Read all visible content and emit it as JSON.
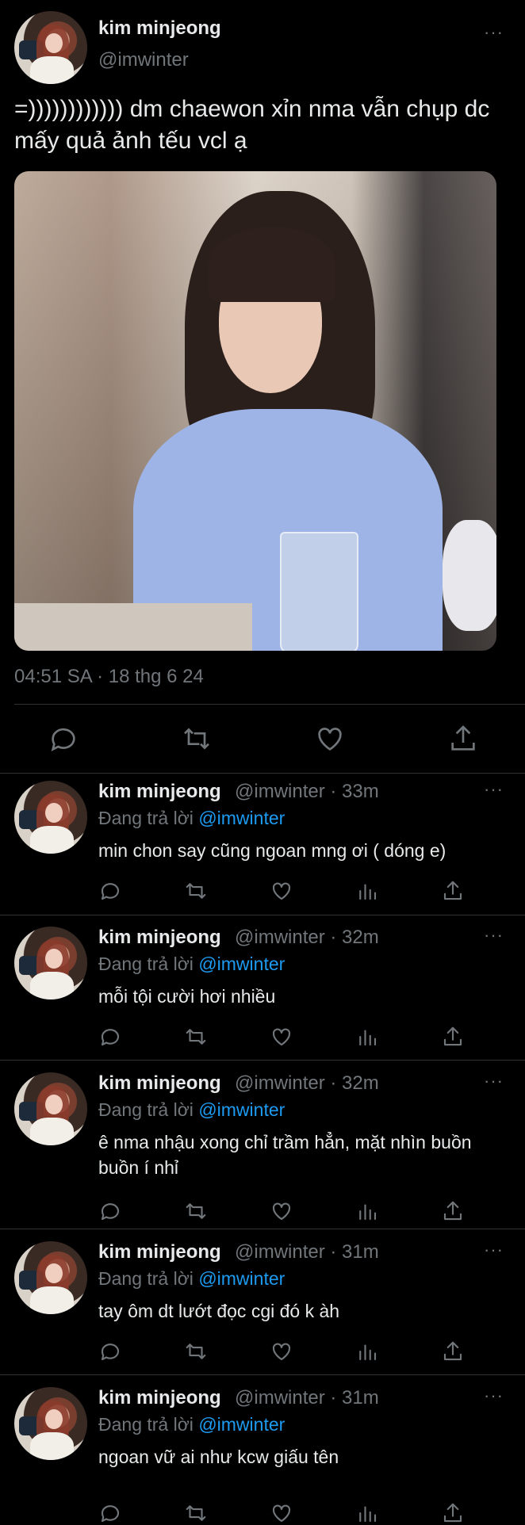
{
  "tweet": {
    "author_name": "kim minjeong",
    "author_handle": "@imwinter",
    "more_icon": "···",
    "text": "=)))))))))))) dm chaewon xỉn nma vẫn chụp dc mấy quả ảnh tếu vcl ạ",
    "timestamp": "04:51 SA · 18 thg 6 24"
  },
  "replies": [
    {
      "name": "kim minjeong",
      "handle": "@imwinter",
      "time": "· 33m",
      "replying_label": "Đang trả lời",
      "mention": "@imwinter",
      "text": "min chon say cũng ngoan mng ơi ( dóng e)"
    },
    {
      "name": "kim minjeong",
      "handle": "@imwinter",
      "time": "· 32m",
      "replying_label": "Đang trả lời",
      "mention": "@imwinter",
      "text": "mỗi tội cười hơi nhiều"
    },
    {
      "name": "kim minjeong",
      "handle": "@imwinter",
      "time": "· 32m",
      "replying_label": "Đang trả lời",
      "mention": "@imwinter",
      "text": "ê nma nhậu xong chỉ trầm hẳn, mặt nhìn buồn buồn í nhỉ"
    },
    {
      "name": "kim minjeong",
      "handle": "@imwinter",
      "time": "· 31m",
      "replying_label": "Đang trả lời",
      "mention": "@imwinter",
      "text": "tay ôm dt lướt đọc cgi đó k àh"
    },
    {
      "name": "kim minjeong",
      "handle": "@imwinter",
      "time": "· 31m",
      "replying_label": "Đang trả lời",
      "mention": "@imwinter",
      "text": "ngoan vữ ai như kcw giấu tên"
    }
  ],
  "colors": {
    "background": "#000000",
    "text": "#e7e9ea",
    "muted": "#71767b",
    "link": "#1d9bf0",
    "divider": "#2f3336"
  },
  "icons": [
    "reply-icon",
    "retweet-icon",
    "like-icon",
    "views-icon",
    "share-icon",
    "more-icon"
  ]
}
